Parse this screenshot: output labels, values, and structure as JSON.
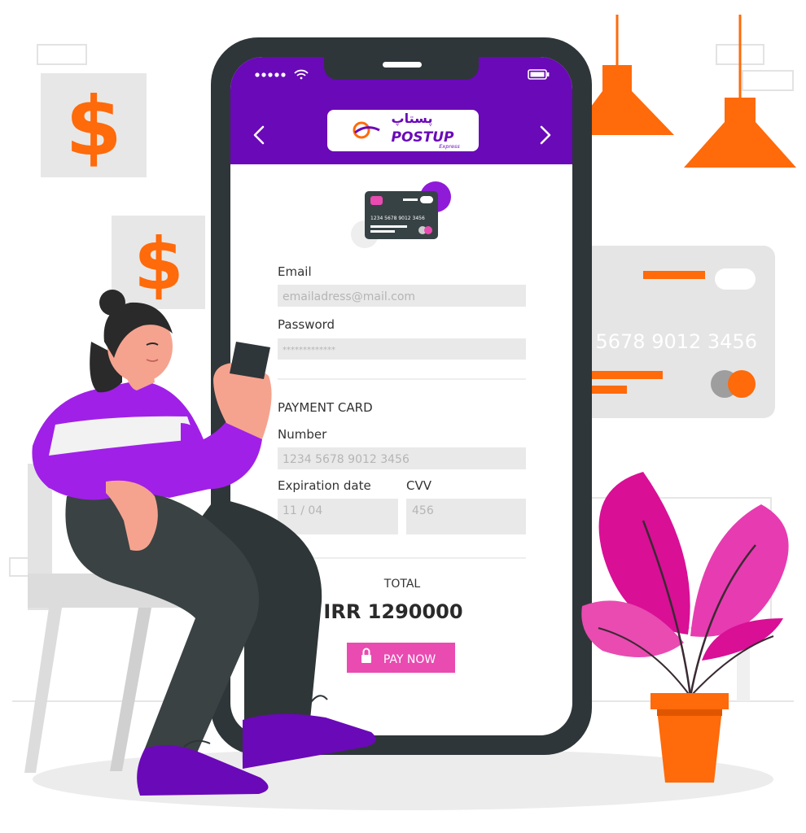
{
  "colors": {
    "accent_purple": "#6a09b8",
    "pink_button": "#e94bb1",
    "orange": "#ff6a0a",
    "phone_frame": "#2e3639",
    "field_bg": "#e9e9e9",
    "plant_pink": "#d90f96"
  },
  "status_bar": {
    "signal_icon": "dots-signal-icon",
    "wifi_icon": "wifi-icon",
    "battery_icon": "battery-icon"
  },
  "header": {
    "logo_script": "پستاپ",
    "logo_text": "POSTUP",
    "logo_subtext": "Express",
    "prev_icon": "chevron-left-icon",
    "next_icon": "chevron-right-icon"
  },
  "card_icon": {
    "number": "1234 5678 9012 3456"
  },
  "form": {
    "email_label": "Email",
    "email_placeholder": "emailadress@mail.com",
    "password_label": "Password",
    "password_value": "*************",
    "payment_card_heading": "PAYMENT CARD",
    "number_label": "Number",
    "number_placeholder": "1234 5678 9012 3456",
    "expiration_label": "Expiration date",
    "expiration_placeholder": "11 / 04",
    "cvv_label": "CVV",
    "cvv_placeholder": "456"
  },
  "summary": {
    "total_label": "TOTAL",
    "total_amount": "IRR 1290000",
    "pay_button_label": "PAY NOW",
    "lock_icon": "lock-icon"
  },
  "background": {
    "big_card_number": "5678  9012  3456",
    "dollar_symbol": "$"
  }
}
